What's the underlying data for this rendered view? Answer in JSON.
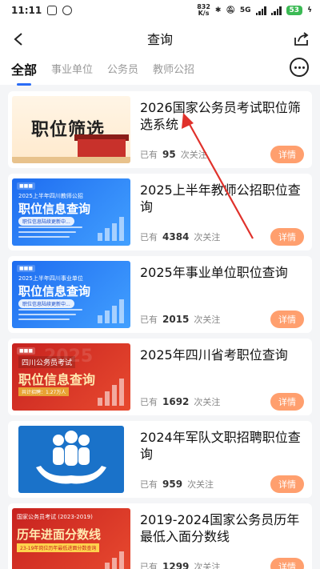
{
  "status_bar": {
    "time": "11:11",
    "net_speed_value": "832",
    "net_speed_unit": "K/s",
    "network": "5G",
    "battery": "53"
  },
  "header": {
    "title": "查询"
  },
  "tabs": [
    {
      "label": "全部",
      "active": true
    },
    {
      "label": "事业单位",
      "active": false
    },
    {
      "label": "公务员",
      "active": false
    },
    {
      "label": "教师公招",
      "active": false
    }
  ],
  "items": [
    {
      "title": "2026国家公务员考试职位筛选系统",
      "prefix": "已有",
      "count": "95",
      "suffix": "次关注",
      "button": "详情",
      "thumb": {
        "main": "职位筛选"
      }
    },
    {
      "title": "2025上半年教师公招职位查询",
      "prefix": "已有",
      "count": "4384",
      "suffix": "次关注",
      "button": "详情",
      "thumb": {
        "sub": "2025上半年四川教师公招",
        "main": "职位信息查询",
        "pill": "职位信息陆续更新中..."
      }
    },
    {
      "title": "2025年事业单位职位查询",
      "prefix": "已有",
      "count": "2015",
      "suffix": "次关注",
      "button": "详情",
      "thumb": {
        "sub": "2025上半年四川事业单位",
        "main": "职位信息查询",
        "pill": "职位信息陆续更新中..."
      }
    },
    {
      "title": "2025年四川省考职位查询",
      "prefix": "已有",
      "count": "1692",
      "suffix": "次关注",
      "button": "详情",
      "thumb": {
        "year": "2025",
        "sub": "四川公务员考试",
        "main": "职位信息查询",
        "pill": "共计招聘：1.27万人"
      }
    },
    {
      "title": "2024年军队文职招聘职位查询",
      "prefix": "已有",
      "count": "959",
      "suffix": "次关注",
      "button": "详情",
      "thumb": {}
    },
    {
      "title": "2019-2024国家公务员历年最低入面分数线",
      "prefix": "已有",
      "count": "1299",
      "suffix": "次关注",
      "button": "详情",
      "thumb": {
        "sub": "国家公务员考试 (2023-2019)",
        "main": "历年进面分数线",
        "pill": "23-19年岗位历年最低进面分数查询"
      }
    }
  ],
  "colors": {
    "accent": "#2a6cf6",
    "detail_button": "#ff9f6e",
    "annotation_arrow": "#e0312b"
  },
  "icons": [
    "back-arrow-icon",
    "share-icon",
    "more-options-icon"
  ]
}
